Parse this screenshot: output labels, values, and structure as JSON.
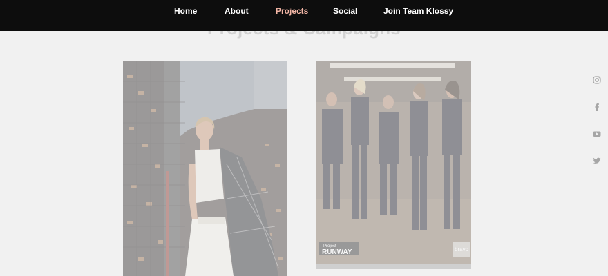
{
  "nav": {
    "items": [
      {
        "label": "Home",
        "active": false
      },
      {
        "label": "About",
        "active": false
      },
      {
        "label": "Projects",
        "active": true
      },
      {
        "label": "Social",
        "active": false
      },
      {
        "label": "Join Team Klossy",
        "active": false
      }
    ]
  },
  "section": {
    "title": "Projects & Campaigns"
  },
  "cards": [
    {
      "image": "city-fashion-campaign-photo"
    },
    {
      "image": "project-runway-cast-photo",
      "logo_text": "Project RUNWAY",
      "network_text": "bravo"
    }
  ],
  "social": {
    "icons": [
      "instagram-icon",
      "facebook-icon",
      "youtube-icon",
      "twitter-icon"
    ]
  },
  "colors": {
    "nav_background": "#0d0d0d",
    "nav_text": "#ffffff",
    "nav_active": "#f3b6a6",
    "page_background": "#f1f1f1",
    "heading": "#d2d2d2",
    "social_icon": "#a6a6a6"
  }
}
